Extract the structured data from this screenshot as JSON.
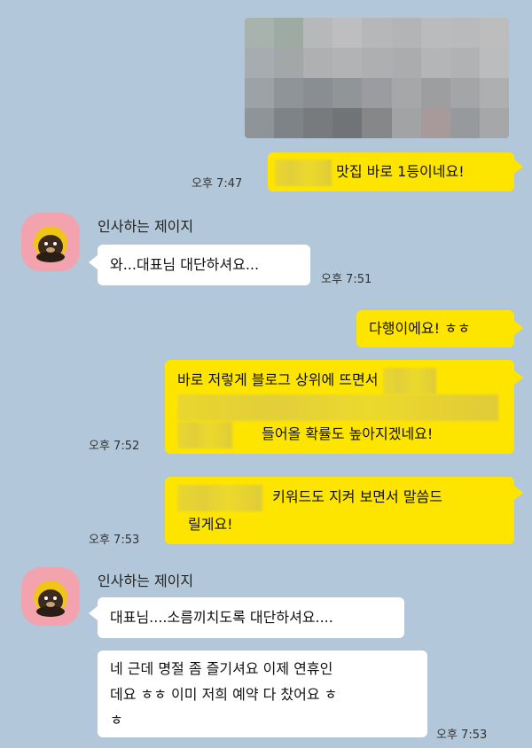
{
  "messages": [
    {
      "id": "m1",
      "text": "맛집 바로 1등이네요!",
      "time": "오후 7:47"
    },
    {
      "id": "m2",
      "sender": "인사하는 제이지",
      "text": "와...대표님 대단하셔요...",
      "time": "오후 7:51"
    },
    {
      "id": "m3",
      "text": "다행이에요! ㅎㅎ"
    },
    {
      "id": "m4",
      "line1": "바로 저렇게 블로그 상위에 뜨면서",
      "line3": "들어올 확률도 높아지겠네요!",
      "time": "오후 7:52"
    },
    {
      "id": "m5",
      "line1": "키워드도 지켜 보면서 말씀드",
      "line2": "릴게요!",
      "time": "오후 7:53"
    },
    {
      "id": "m6",
      "sender": "인사하는 제이지",
      "text": "대표님....소름끼치도록 대단하셔요...."
    },
    {
      "id": "m7",
      "line1": "네 근데 명절 좀 즐기셔요 이제 연휴인",
      "line2": "데요 ㅎㅎ 이미 저희 예약 다 찼어요 ㅎ",
      "line3": "ㅎ",
      "time": "오후 7:53"
    }
  ],
  "colors": {
    "background": "#b2c7d9",
    "my_bubble": "#fee500",
    "other_bubble": "#ffffff",
    "avatar_bg": "#f2a3ad"
  },
  "icons": {
    "avatar": "character-avatar-icon"
  }
}
